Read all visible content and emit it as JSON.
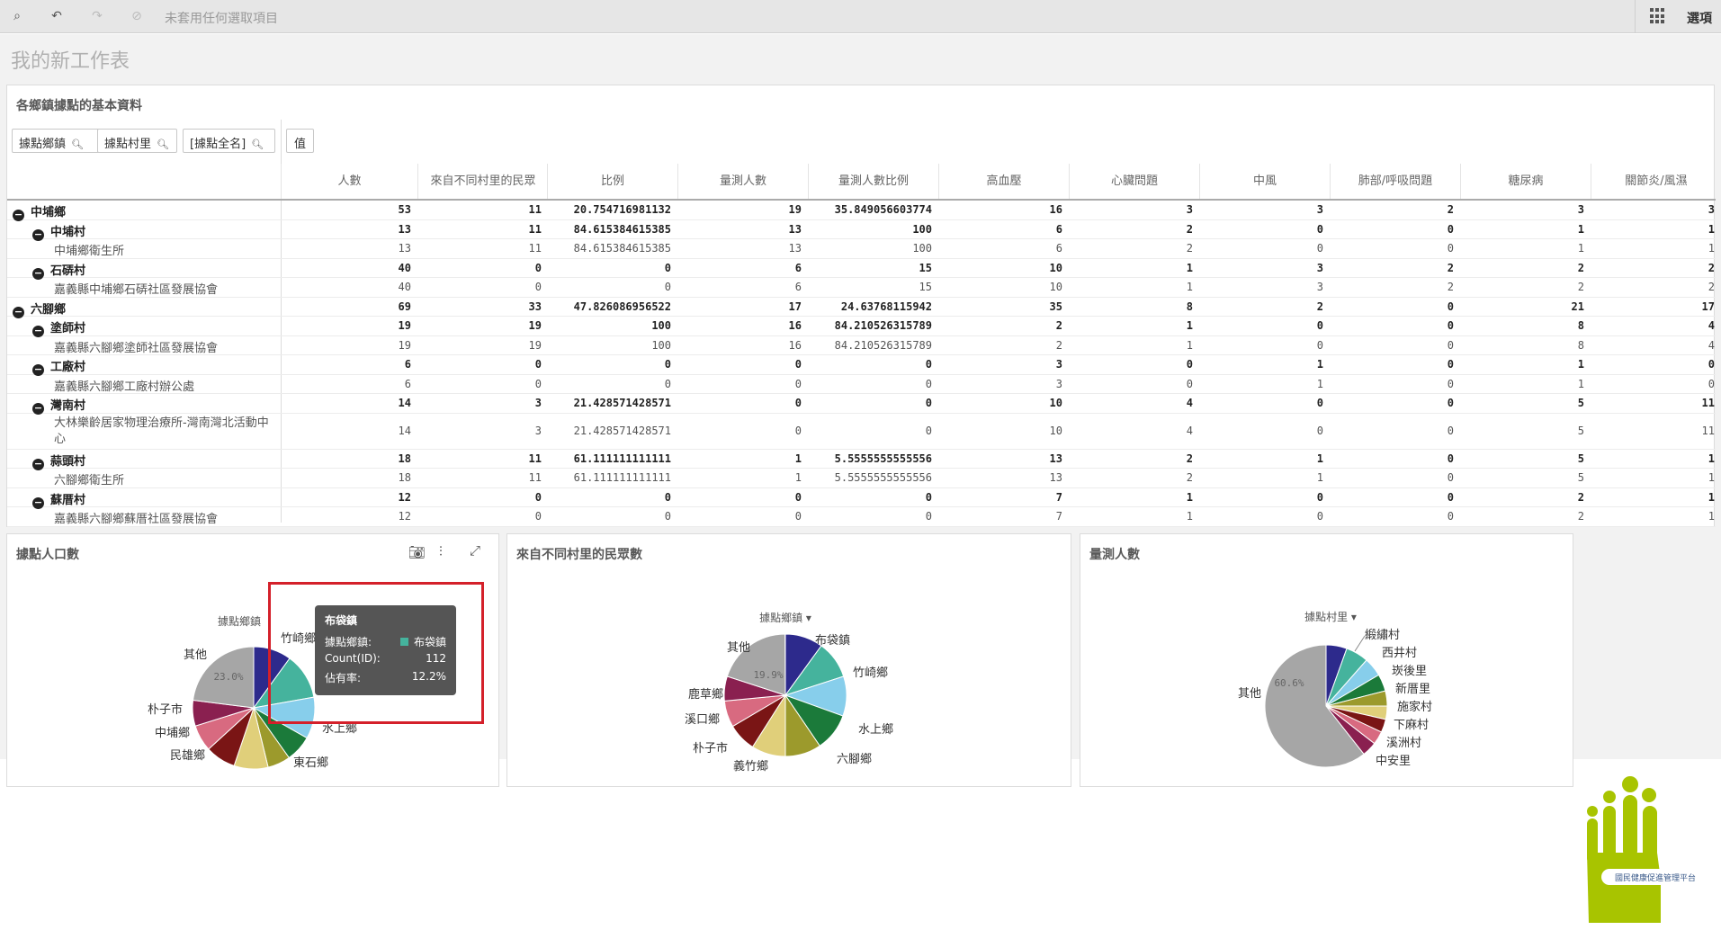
{
  "toolbar": {
    "selection_text": "未套用任何選取項目",
    "options_label": "選項"
  },
  "sheet": {
    "title": "我的新工作表"
  },
  "table": {
    "title": "各鄉鎮據點的基本資料",
    "filters": [
      "據點鄉鎮",
      "據點村里",
      "[據點全名]"
    ],
    "value_button": "值",
    "columns": [
      "人數",
      "來自不同村里的民眾",
      "比例",
      "量測人數",
      "量測人數比例",
      "高血壓",
      "心臟問題",
      "中風",
      "肺部/呼吸問題",
      "糖尿病",
      "關節炎/風濕"
    ],
    "rows": [
      {
        "level": 0,
        "label": "中埔鄉",
        "values": [
          "53",
          "11",
          "20.754716981132",
          "19",
          "35.849056603774",
          "16",
          "3",
          "3",
          "2",
          "3",
          "3"
        ]
      },
      {
        "level": 1,
        "label": "中埔村",
        "values": [
          "13",
          "11",
          "84.615384615385",
          "13",
          "100",
          "6",
          "2",
          "0",
          "0",
          "1",
          "1"
        ]
      },
      {
        "level": 2,
        "label": "中埔鄉衛生所",
        "values": [
          "13",
          "11",
          "84.615384615385",
          "13",
          "100",
          "6",
          "2",
          "0",
          "0",
          "1",
          "1"
        ]
      },
      {
        "level": 1,
        "label": "石硦村",
        "values": [
          "40",
          "0",
          "0",
          "6",
          "15",
          "10",
          "1",
          "3",
          "2",
          "2",
          "2"
        ]
      },
      {
        "level": 2,
        "label": "嘉義縣中埔鄉石硦社區發展協會",
        "values": [
          "40",
          "0",
          "0",
          "6",
          "15",
          "10",
          "1",
          "3",
          "2",
          "2",
          "2"
        ]
      },
      {
        "level": 0,
        "label": "六腳鄉",
        "values": [
          "69",
          "33",
          "47.826086956522",
          "17",
          "24.63768115942",
          "35",
          "8",
          "2",
          "0",
          "21",
          "17"
        ]
      },
      {
        "level": 1,
        "label": "塗師村",
        "values": [
          "19",
          "19",
          "100",
          "16",
          "84.210526315789",
          "2",
          "1",
          "0",
          "0",
          "8",
          "4"
        ]
      },
      {
        "level": 2,
        "label": "嘉義縣六腳鄉塗師社區發展協會",
        "values": [
          "19",
          "19",
          "100",
          "16",
          "84.210526315789",
          "2",
          "1",
          "0",
          "0",
          "8",
          "4"
        ]
      },
      {
        "level": 1,
        "label": "工廠村",
        "values": [
          "6",
          "0",
          "0",
          "0",
          "0",
          "3",
          "0",
          "1",
          "0",
          "1",
          "0"
        ]
      },
      {
        "level": 2,
        "label": "嘉義縣六腳鄉工廠村辦公處",
        "values": [
          "6",
          "0",
          "0",
          "0",
          "0",
          "3",
          "0",
          "1",
          "0",
          "1",
          "0"
        ]
      },
      {
        "level": 1,
        "label": "灣南村",
        "values": [
          "14",
          "3",
          "21.428571428571",
          "0",
          "0",
          "10",
          "4",
          "0",
          "0",
          "5",
          "11"
        ]
      },
      {
        "level": 2,
        "label": "大林樂齡居家物理治療所-灣南灣北活動中心",
        "values": [
          "14",
          "3",
          "21.428571428571",
          "0",
          "0",
          "10",
          "4",
          "0",
          "0",
          "5",
          "11"
        ]
      },
      {
        "level": 1,
        "label": "蒜頭村",
        "values": [
          "18",
          "11",
          "61.111111111111",
          "1",
          "5.5555555555556",
          "13",
          "2",
          "1",
          "0",
          "5",
          "1"
        ]
      },
      {
        "level": 2,
        "label": "六腳鄉衛生所",
        "values": [
          "18",
          "11",
          "61.111111111111",
          "1",
          "5.5555555555556",
          "13",
          "2",
          "1",
          "0",
          "5",
          "1"
        ]
      },
      {
        "level": 1,
        "label": "蘇厝村",
        "values": [
          "12",
          "0",
          "0",
          "0",
          "0",
          "7",
          "1",
          "0",
          "0",
          "2",
          "1"
        ]
      },
      {
        "level": 2,
        "label": "嘉義縣六腳鄉蘇厝社區發展協會",
        "values": [
          "12",
          "0",
          "0",
          "0",
          "0",
          "7",
          "1",
          "0",
          "0",
          "2",
          "1"
        ]
      }
    ]
  },
  "chart1": {
    "title": "據點人口數",
    "dim_label": "據點鄉鎮",
    "other_pct": "23.0%",
    "labels": [
      "竹崎鄉",
      "水上鄉",
      "東石鄉",
      "民雄鄉",
      "中埔鄉",
      "朴子市",
      "其他"
    ]
  },
  "tooltip": {
    "title": "布袋鎮",
    "k1": "據點鄉鎮:",
    "v1": "布袋鎮",
    "k2": "Count(ID):",
    "v2": "112",
    "k3": "佔有率:",
    "v3": "12.2%"
  },
  "chart2": {
    "title": "來自不同村里的民眾數",
    "dim_label": "據點鄉鎮",
    "other_pct": "19.9%",
    "labels": [
      "布袋鎮",
      "竹崎鄉",
      "水上鄉",
      "六腳鄉",
      "義竹鄉",
      "朴子市",
      "溪口鄉",
      "鹿草鄉",
      "其他"
    ]
  },
  "chart3": {
    "title": "量測人數",
    "dim_label": "據點村里",
    "other_pct": "60.6%",
    "labels": [
      "緞繡村",
      "西井村",
      "崁後里",
      "新厝里",
      "施家村",
      "下麻村",
      "溪洲村",
      "中安里",
      "其他"
    ]
  },
  "logo": {
    "text": "國民健康促進管理平台"
  },
  "colors": {
    "navy": "#2d2a8c",
    "teal": "#45b39d",
    "sky": "#87ceeb",
    "green": "#1b7a3a",
    "olive": "#9c9a2c",
    "sand": "#e0cf7a",
    "maroon": "#7a1515",
    "rose": "#d86a80",
    "plum": "#8a2050",
    "gray": "#a6a6a6",
    "logo": "#a8c400"
  }
}
